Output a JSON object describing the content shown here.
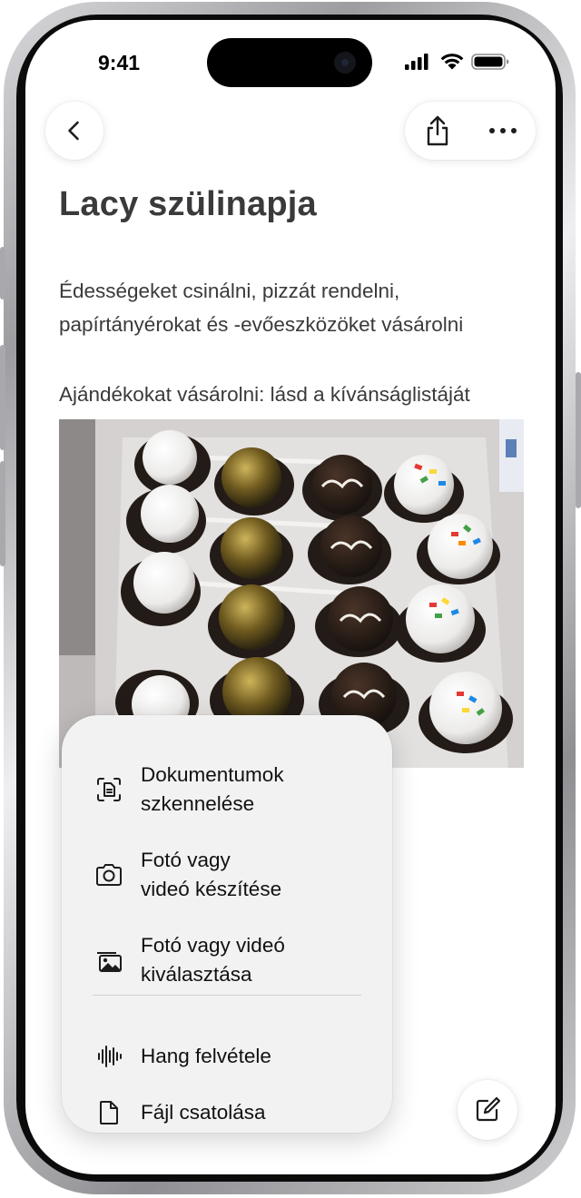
{
  "status_bar": {
    "time": "9:41"
  },
  "note": {
    "title": "Lacy szülinapja",
    "paragraph_1": "Édességeket csinálni, pizzát rendelni, papírtányérokat és -evőeszközöket vásárolni",
    "paragraph_2": "Ajándékokat vásárolni: lásd a kívánságlistáját"
  },
  "toolbar": {
    "back_icon": "chevron-left-icon",
    "share_icon": "share-icon",
    "more_icon": "ellipsis-icon",
    "compose_icon": "compose-icon"
  },
  "attach_menu": {
    "items": [
      {
        "icon": "scan-document-icon",
        "line1": "Dokumentumok",
        "line2": "szkennelése"
      },
      {
        "icon": "camera-icon",
        "line1": "Fotó vagy",
        "line2": "videó készítése"
      },
      {
        "icon": "photo-library-icon",
        "line1": "Fotó vagy videó",
        "line2": "kiválasztása"
      },
      {
        "icon": "waveform-icon",
        "line1": "Hang felvétele"
      },
      {
        "icon": "document-icon",
        "line1": "Fájl csatolása"
      }
    ]
  },
  "colors": {
    "text_primary": "#3a3a3c",
    "menu_background": "#f2f2f2",
    "frame": "#0b0b0c"
  }
}
